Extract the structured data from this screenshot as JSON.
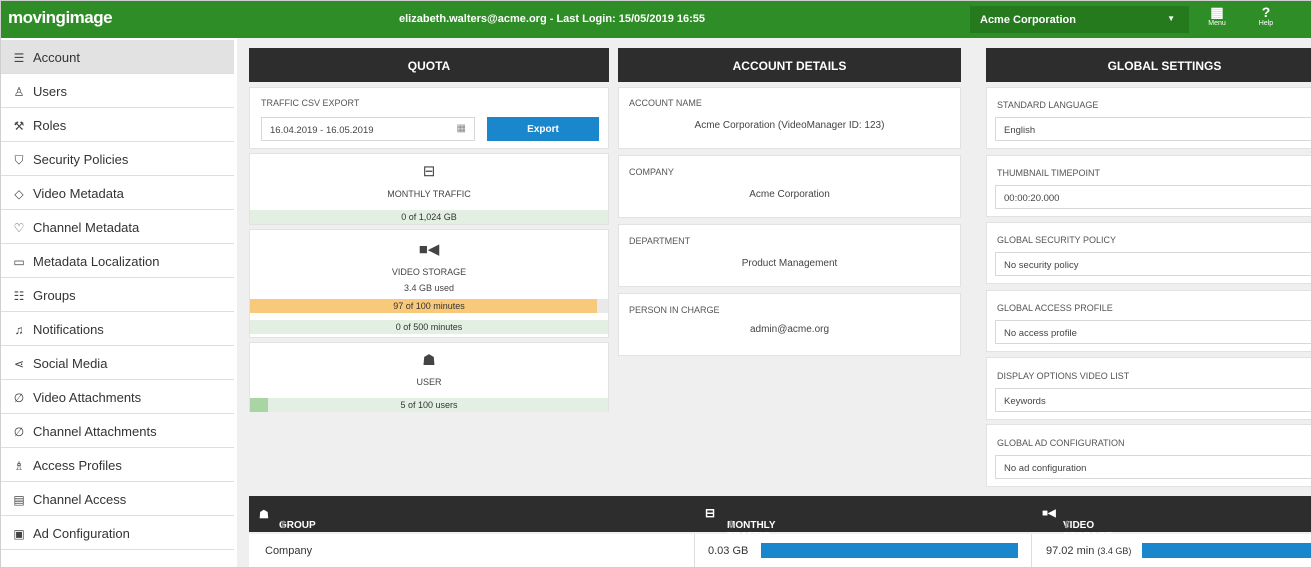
{
  "topbar": {
    "logo": "movingimage",
    "login_text": "elizabeth.walters@acme.org - Last Login: 15/05/2019 16:55",
    "organization": "Acme Corporation",
    "menu_label": "Menu",
    "help_label": "Help"
  },
  "sidebar": {
    "items": [
      {
        "label": "Account",
        "icon": "list-icon"
      },
      {
        "label": "Users",
        "icon": "user-icon"
      },
      {
        "label": "Roles",
        "icon": "wrench-icon"
      },
      {
        "label": "Security Policies",
        "icon": "shield-icon"
      },
      {
        "label": "Video Metadata",
        "icon": "tag-icon"
      },
      {
        "label": "Channel Metadata",
        "icon": "badge-icon"
      },
      {
        "label": "Metadata Localization",
        "icon": "chat-icon"
      },
      {
        "label": "Groups",
        "icon": "people-icon"
      },
      {
        "label": "Notifications",
        "icon": "bell-icon"
      },
      {
        "label": "Social Media",
        "icon": "share-icon"
      },
      {
        "label": "Video Attachments",
        "icon": "paperclip-icon"
      },
      {
        "label": "Channel Attachments",
        "icon": "paperclip-icon"
      },
      {
        "label": "Access Profiles",
        "icon": "user-key-icon"
      },
      {
        "label": "Channel Access",
        "icon": "stack-icon"
      },
      {
        "label": "Ad Configuration",
        "icon": "ad-icon"
      }
    ]
  },
  "quota": {
    "title": "QUOTA",
    "traffic_export_label": "TRAFFIC CSV EXPORT",
    "date_range": "16.04.2019 - 16.05.2019",
    "export_button": "Export",
    "monthly_traffic_label": "MONTHLY TRAFFIC",
    "monthly_traffic_value": "0 of 1,024 GB",
    "monthly_traffic_fraction": 0,
    "video_storage_label": "VIDEO STORAGE",
    "video_storage_used": "3.4 GB used",
    "storage_bar1": "97 of 100 minutes",
    "storage_bar1_fraction": 0.97,
    "storage_bar2": "0 of 500 minutes",
    "storage_bar2_fraction": 0,
    "user_label": "USER",
    "user_value": "5 of 100 users",
    "user_fraction": 0.05
  },
  "account_details": {
    "title": "ACCOUNT DETAILS",
    "account_name_label": "ACCOUNT NAME",
    "account_name_value": "Acme Corporation (VideoManager ID: 123)",
    "company_label": "COMPANY",
    "company_value": "Acme Corporation",
    "department_label": "DEPARTMENT",
    "department_value": "Product Management",
    "person_label": "PERSON IN CHARGE",
    "person_value": "admin@acme.org"
  },
  "global_settings": {
    "title": "GLOBAL SETTINGS",
    "language_label": "STANDARD LANGUAGE",
    "language_value": "English",
    "thumbnail_label": "THUMBNAIL TIMEPOINT",
    "thumbnail_value": "00:00:20.000",
    "security_label": "GLOBAL SECURITY POLICY",
    "security_value": "No security policy",
    "access_label": "GLOBAL ACCESS PROFILE",
    "access_value": "No access profile",
    "display_label": "DISPLAY OPTIONS VIDEO LIST",
    "display_value": "Keywords",
    "ad_label": "GLOBAL AD CONFIGURATION",
    "ad_value": "No ad configuration"
  },
  "table": {
    "headers": {
      "group": "GROUP",
      "traffic": "MONTHLY TRAFFIC",
      "storage": "VIDEO STORAGE"
    },
    "rows": [
      {
        "group": "Company",
        "traffic": "0.03 GB",
        "storage": "97.02 min",
        "storage_sub": "(3.4 GB)"
      }
    ]
  },
  "colors": {
    "topbar": "#2f8d27",
    "accent": "#1a87cc",
    "warning_bar": "#f8c97a",
    "ok_bar": "#e3efe2",
    "ok_fill": "#a9d5a4"
  }
}
